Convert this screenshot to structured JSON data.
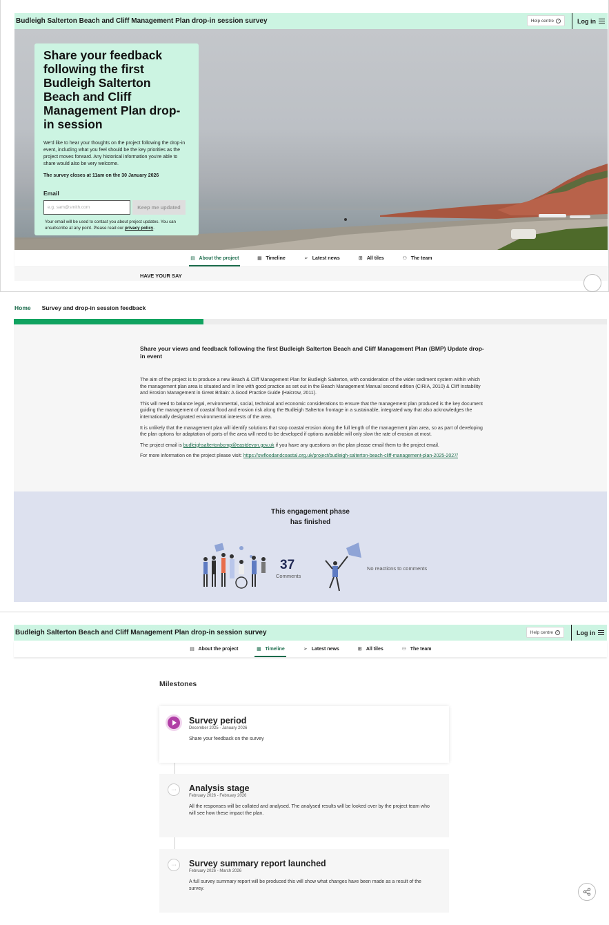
{
  "site": {
    "title": "Budleigh Salterton Beach and Cliff Management Plan drop-in session survey",
    "help_label": "Help centre",
    "login_label": "Log in"
  },
  "hero": {
    "heading": "Share your feedback following the first Budleigh Salterton Beach and Cliff Management Plan drop-in session",
    "intro": "We'd like to hear your thoughts on the project following the drop-in event, including what you feel should be the key priorities as the project moves forward. Any historical information you're able to share would also be very welcome.",
    "closes": "The survey closes at 11am on the 30 January 2026",
    "email_label": "Email",
    "email_placeholder": "e.g. sam@smith.com",
    "button_label": "Keep me updated",
    "fine_print": "Your email will be used to contact you about project updates. You can unsubscribe at any point. Please read our",
    "privacy_link": "privacy policy",
    "fine_print_end": "."
  },
  "tabs": [
    {
      "label": "About the project",
      "icon": "document-icon"
    },
    {
      "label": "Timeline",
      "icon": "calendar-icon"
    },
    {
      "label": "Latest news",
      "icon": "send-icon"
    },
    {
      "label": "All tiles",
      "icon": "grid-icon"
    },
    {
      "label": "The team",
      "icon": "people-icon"
    }
  ],
  "have_your_say": "HAVE YOUR SAY",
  "breadcrumb": {
    "home": "Home",
    "current": "Survey and drop-in session feedback"
  },
  "survey_progress": 0.32,
  "survey": {
    "heading": "Share your views and feedback following the first Budleigh Salterton Beach and Cliff Management Plan (BMP) Update drop-in event",
    "paragraphs": [
      "The aim of the project is to produce a new Beach & Cliff Management Plan for Budleigh Salterton, with consideration of the wider sediment system within which the management plan area is situated and in line with good practice as set out in the Beach Management Manual second edition (CIRIA, 2010) & Cliff Instability and Erosion Management in Great Britain: A Good Practice Guide (Halcrow, 2011).",
      "This will need to balance legal, environmental, social, technical and economic considerations to ensure that the management plan produced is the key document guiding the management of coastal flood and erosion risk along the Budleigh Salterton frontage in a sustainable, integrated way that also acknowledges the internationally designated environmental interests of the area.",
      "It is unlikely that the management plan will identify solutions that stop coastal erosion along the full length of the management plan area, so as part of developing the plan options for adaptation of parts of the area will need to be developed if options available will only slow the rate of erosion at most."
    ],
    "email_pre": "The project email is",
    "email": "budleighsaltertonbcmp@eastdevon.gov.uk",
    "email_post": "if you have any questions on the plan please email them to the project email.",
    "more_pre": "For more information on the project please visit:",
    "more_link": "https://swfloodandcoastal.org.uk/project/budleigh-salterton-beach-cliff-management-plan-2025-2027/"
  },
  "engagement": {
    "line1": "This engagement phase",
    "line2": "has finished",
    "comments_count": "37",
    "comments_label": "Comments",
    "reactions": "No reactions to comments"
  },
  "milestones": {
    "title": "Milestones",
    "items": [
      {
        "title": "Survey period",
        "dates": "December 2025 - January 2026",
        "desc": "Share your feedback on the survey",
        "status": "current"
      },
      {
        "title": "Analysis stage",
        "dates": "February 2026 - February 2026",
        "desc": "All the responses will be collated and analysed. The analysed results will be looked over by the project team who will see how these impact the plan.",
        "status": "pending"
      },
      {
        "title": "Survey summary report launched",
        "dates": "February 2026 - March 2026",
        "desc": "A full survey summary report will be produced this will show what changes have been made as a result of the survey.",
        "status": "pending"
      }
    ]
  },
  "colors": {
    "header_bg": "#ccf4e2",
    "brand_green": "#1b6b4b",
    "progress_green": "#10a360",
    "engagement_bg": "#dde1ef",
    "milestone_active": "#b13fa6"
  }
}
